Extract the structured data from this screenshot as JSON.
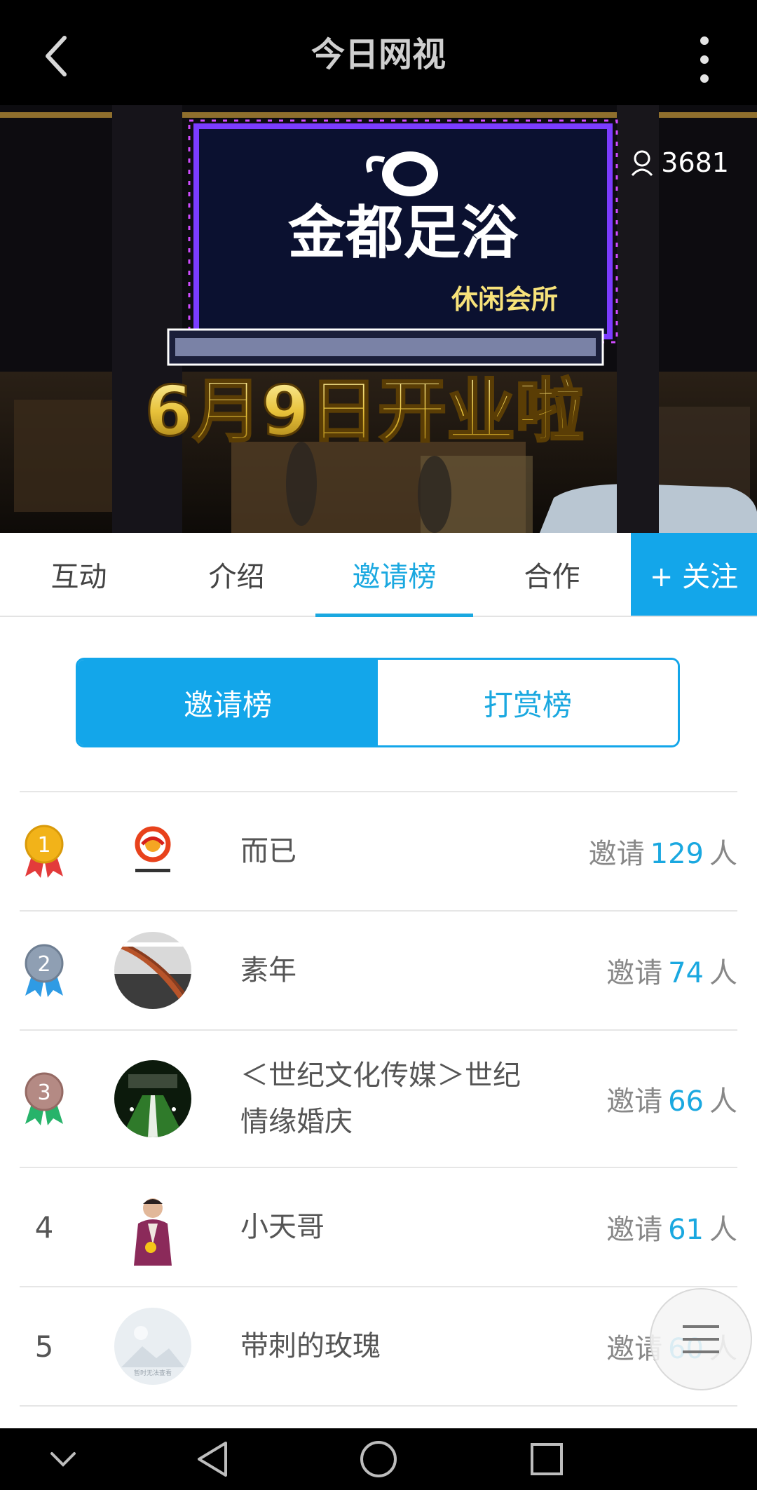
{
  "header": {
    "title": "今日网视"
  },
  "hero": {
    "sign_title": "金都足浴",
    "sign_subtitle": "休闲会所",
    "banner_text": "6月9日开业啦",
    "view_count": "3681"
  },
  "tabs": [
    {
      "label": "互动"
    },
    {
      "label": "介绍"
    },
    {
      "label": "邀请榜"
    },
    {
      "label": "合作"
    }
  ],
  "follow_label": "+ 关注",
  "segment": {
    "left": "邀请榜",
    "right": "打赏榜"
  },
  "ranking": {
    "invite_prefix": "邀请",
    "invite_suffix": "人",
    "rows": [
      {
        "rank": "1",
        "name": "而已",
        "count": "129"
      },
      {
        "rank": "2",
        "name": "素年",
        "count": "74"
      },
      {
        "rank": "3",
        "name": "＜世纪文化传媒＞世纪情缘婚庆",
        "count": "66"
      },
      {
        "rank": "4",
        "name": "小天哥",
        "count": "61"
      },
      {
        "rank": "5",
        "name": "带刺的玫瑰",
        "count": "60"
      }
    ]
  },
  "avatar_placeholder_text": "暂时无法查看",
  "colors": {
    "accent": "#13a6ea",
    "gold_medal": "#f2b319",
    "silver_medal": "#8f9fb3",
    "bronze_medal": "#b48a84"
  }
}
